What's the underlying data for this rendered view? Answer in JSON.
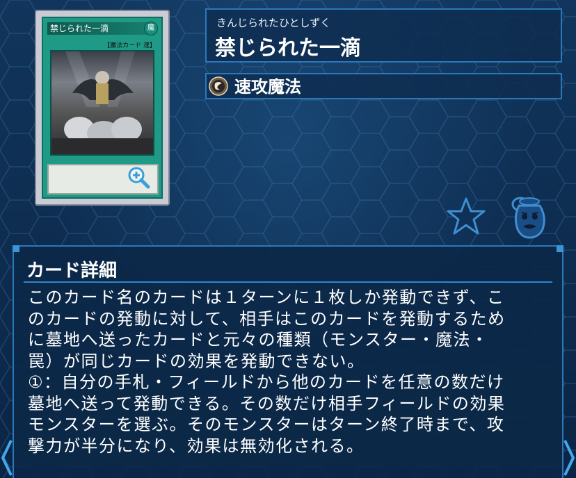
{
  "card": {
    "image_name": "禁じられた一滴",
    "attribute_label": "魔",
    "type_line": "【魔法カード 速】"
  },
  "header": {
    "ruby": "きんじられたひとしずく",
    "title": "禁じられた一滴",
    "type_label": "速攻魔法",
    "type_icon": "quick-play-icon"
  },
  "actions": {
    "favorite_icon": "star-icon",
    "pot_icon": "pot-icon",
    "zoom_icon": "zoom-in-icon"
  },
  "detail": {
    "heading": "カード詳細",
    "lines": [
      "このカード名のカードは１ターンに１枚しか発動できず、こ",
      "のカードの発動に対して、相手はこのカードを発動するため",
      "に墓地へ送ったカードと元々の種類（モンスター・魔法・",
      "罠）が同じカードの効果を発動できない。",
      "①：自分の手札・フィールドから他のカードを任意の数だけ",
      "墓地へ送って発動できる。その数だけ相手フィールドの効果",
      "モンスターを選ぶ。そのモンスターはターン終了時まで、攻",
      "撃力が半分になり、効果は無効化される。"
    ]
  },
  "colors": {
    "accent": "#2b78ba",
    "spell_card": "#1e9a86",
    "background": "#0d2a4a"
  }
}
